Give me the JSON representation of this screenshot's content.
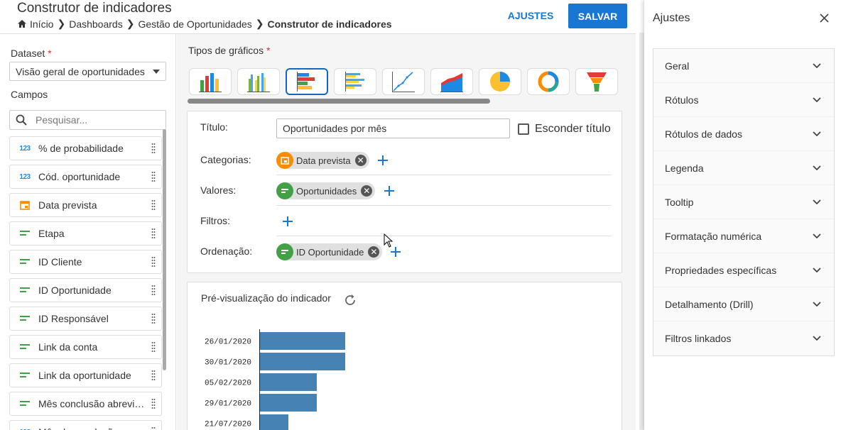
{
  "header": {
    "title": "Construtor de indicadores",
    "breadcrumb": [
      "Início",
      "Dashboards",
      "Gestão de Oportunidades",
      "Construtor de indicadores"
    ],
    "ajustes_label": "AJUSTES",
    "salvar_label": "SALVAR"
  },
  "left": {
    "dataset_label": "Dataset",
    "required_mark": "*",
    "dataset_value": "Visão geral de oportunidades",
    "campos_label": "Campos",
    "search_placeholder": "Pesquisar...",
    "fields": [
      {
        "label": "% de probabilidade",
        "type": "number",
        "icon": "123"
      },
      {
        "label": "Cód. oportunidade",
        "type": "number",
        "icon": "123"
      },
      {
        "label": "Data prevista",
        "type": "date"
      },
      {
        "label": "Etapa",
        "type": "text"
      },
      {
        "label": "ID Cliente",
        "type": "text"
      },
      {
        "label": "ID Oportunidade",
        "type": "text"
      },
      {
        "label": "ID Responsável",
        "type": "text"
      },
      {
        "label": "Link da conta",
        "type": "text"
      },
      {
        "label": "Link da oportunidade",
        "type": "text"
      },
      {
        "label": "Mês conclusão abreviado",
        "type": "text"
      },
      {
        "label": "Mês de conclusão",
        "type": "number",
        "icon": "123"
      }
    ]
  },
  "center": {
    "tipos_label": "Tipos de gráficos",
    "required_mark": "*",
    "config": {
      "titulo_label": "Título:",
      "titulo_value": "Oportunidades por mês",
      "esconder_titulo_label": "Esconder título",
      "categorias_label": "Categorias:",
      "categorias_chip": "Data prevista",
      "valores_label": "Valores:",
      "valores_chip": "Oportunidades",
      "filtros_label": "Filtros:",
      "ordenacao_label": "Ordenação:",
      "ordenacao_chip": "ID Oportunidade"
    },
    "preview_title": "Pré-visualização do indicador"
  },
  "chart_data": {
    "type": "bar",
    "orientation": "horizontal",
    "categories": [
      "26/01/2020",
      "30/01/2020",
      "05/02/2020",
      "29/01/2020",
      "21/07/2020"
    ],
    "values": [
      3,
      3,
      2,
      2,
      1
    ],
    "title": "",
    "xlabel": "",
    "ylabel": "",
    "xlim": [
      0,
      3
    ],
    "color": "#4682b4",
    "grid": false
  },
  "right": {
    "title": "Ajustes",
    "items": [
      "Geral",
      "Rótulos",
      "Rótulos de dados",
      "Legenda",
      "Tooltip",
      "Formatação numérica",
      "Propriedades específicas",
      "Detalhamento (Drill)",
      "Filtros linkados"
    ]
  },
  "colors": {
    "primary": "#1976d2",
    "chip_green": "#43a047",
    "chip_orange": "#fb8c00",
    "bar": "#4682b4"
  }
}
